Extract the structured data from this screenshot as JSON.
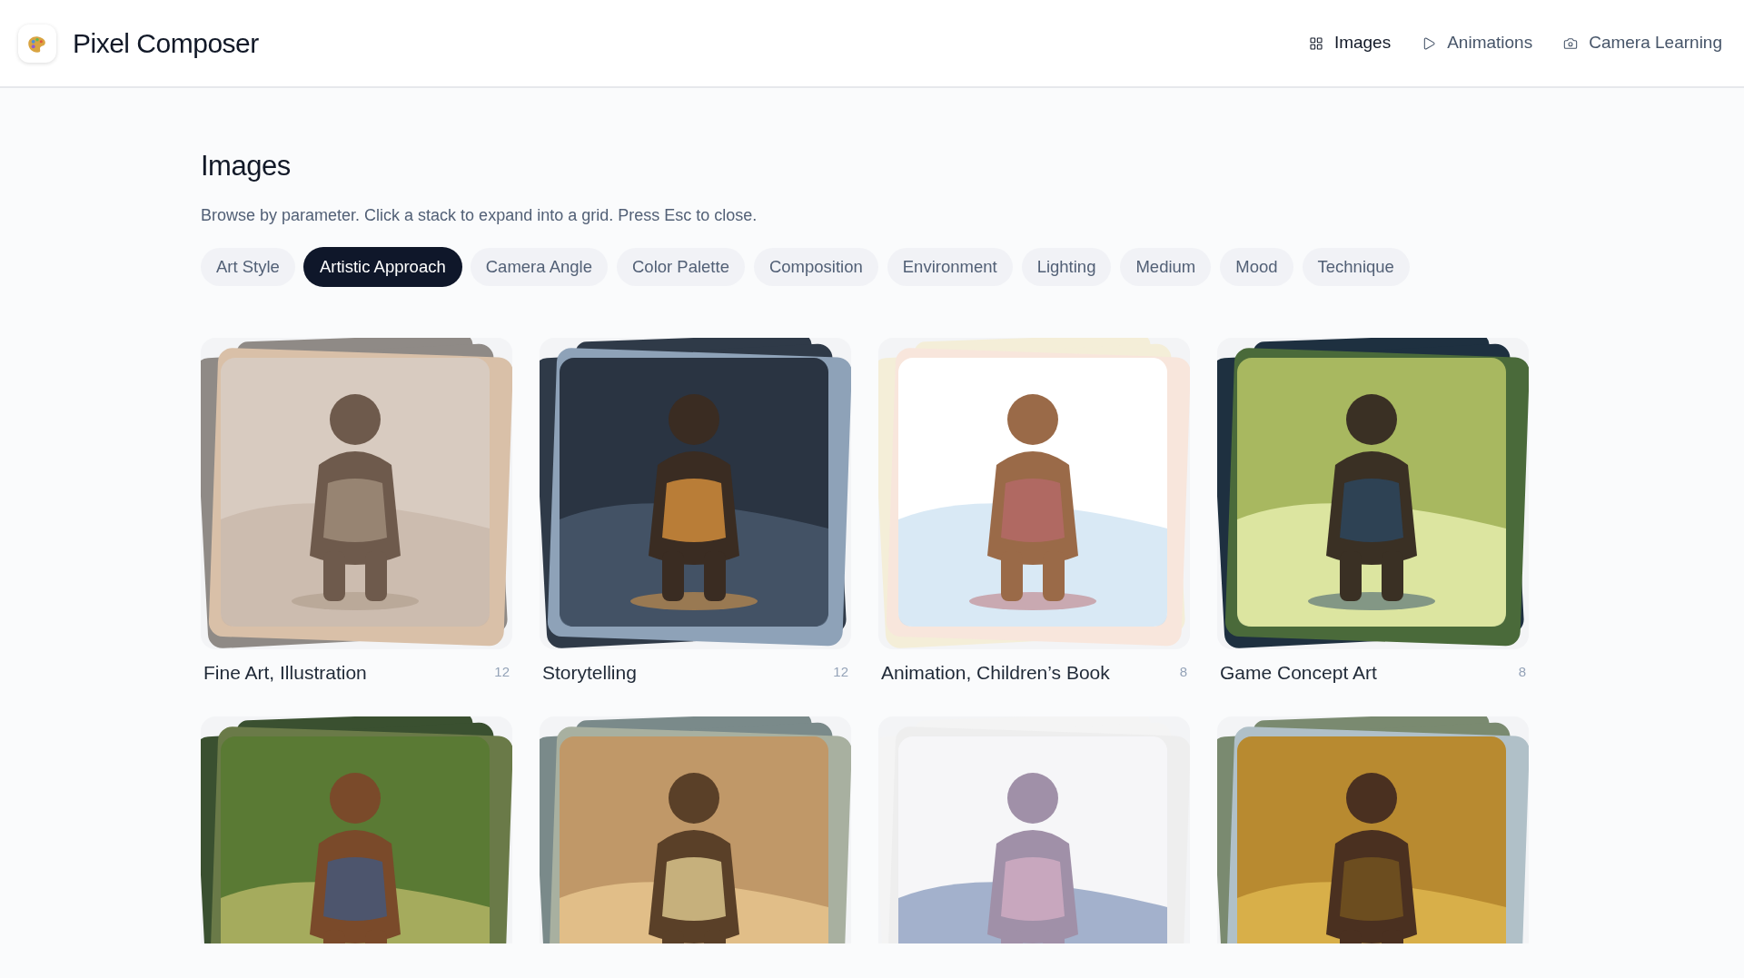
{
  "app": {
    "title": "Pixel Composer"
  },
  "nav": [
    {
      "label": "Images",
      "kind": "grid",
      "selected": true
    },
    {
      "label": "Animations",
      "kind": "play",
      "selected": false
    },
    {
      "label": "Camera Learning",
      "kind": "camera",
      "selected": false
    }
  ],
  "page": {
    "title": "Images",
    "subtitle": "Browse by parameter. Click a stack to expand into a grid. Press Esc to close."
  },
  "chips": [
    {
      "label": "Art Style",
      "selected": false
    },
    {
      "label": "Artistic Approach",
      "selected": true
    },
    {
      "label": "Camera Angle",
      "selected": false
    },
    {
      "label": "Color Palette",
      "selected": false
    },
    {
      "label": "Composition",
      "selected": false
    },
    {
      "label": "Environment",
      "selected": false
    },
    {
      "label": "Lighting",
      "selected": false
    },
    {
      "label": "Medium",
      "selected": false
    },
    {
      "label": "Mood",
      "selected": false
    },
    {
      "label": "Technique",
      "selected": false
    }
  ],
  "stacks": [
    {
      "kind": "picture",
      "label": "Fine Art, Illustration",
      "count": "12"
    },
    {
      "kind": "picture",
      "label": "Storytelling",
      "count": "12"
    },
    {
      "kind": "picture",
      "label": "Animation, Children’s Book",
      "count": "8"
    },
    {
      "kind": "picture",
      "label": "Game Concept Art",
      "count": "8"
    },
    {
      "kind": "picture"
    },
    {
      "kind": "picture"
    },
    {
      "kind": "picture"
    },
    {
      "kind": "picture"
    }
  ]
}
